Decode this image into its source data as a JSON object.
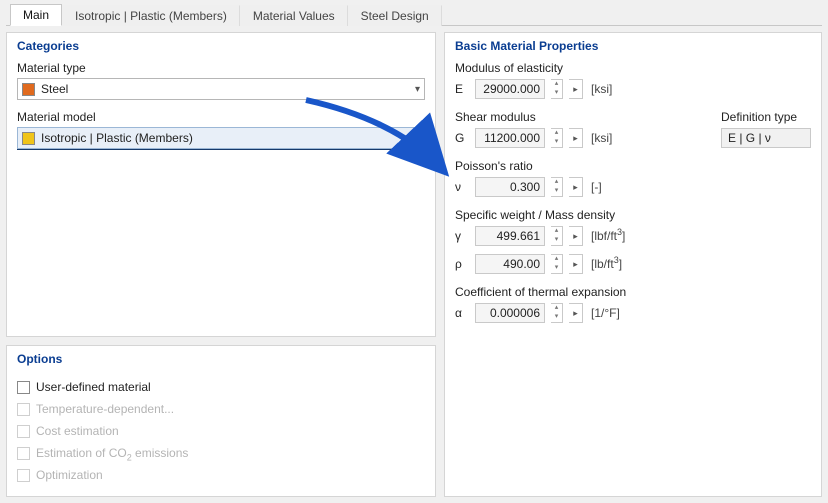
{
  "tabs": {
    "main": "Main",
    "iso": "Isotropic | Plastic (Members)",
    "matvals": "Material Values",
    "steel": "Steel Design"
  },
  "left": {
    "categories_title": "Categories",
    "material_type_label": "Material type",
    "material_type_value": "Steel",
    "material_model_label": "Material model",
    "material_model_value": "Isotropic | Plastic (Members)",
    "options_title": "Options",
    "opt_user": "User-defined material",
    "opt_temp": "Temperature-dependent...",
    "opt_cost": "Cost estimation",
    "opt_co2_pre": "Estimation of CO",
    "opt_co2_post": " emissions",
    "opt_optim": "Optimization"
  },
  "right": {
    "title": "Basic Material Properties",
    "mod_e_label": "Modulus of elasticity",
    "sym_E": "E",
    "val_E": "29000.000",
    "unit_E": "[ksi]",
    "shear_label": "Shear modulus",
    "sym_G": "G",
    "val_G": "11200.000",
    "unit_G": "[ksi]",
    "def_label": "Definition type",
    "def_value": "E | G | ν",
    "pois_label": "Poisson's ratio",
    "sym_nu": "ν",
    "val_nu": "0.300",
    "unit_nu": "[-]",
    "spw_label": "Specific weight / Mass density",
    "sym_gamma": "γ",
    "val_gamma": "499.661",
    "unit_gamma_pre": "[lbf/ft",
    "unit_gamma_post": "]",
    "sym_rho": "ρ",
    "val_rho": "490.00",
    "unit_rho_pre": "[lb/ft",
    "unit_rho_post": "]",
    "cte_label": "Coefficient of thermal expansion",
    "sym_alpha": "α",
    "val_alpha": "0.000006",
    "unit_alpha": "[1/°F]"
  }
}
